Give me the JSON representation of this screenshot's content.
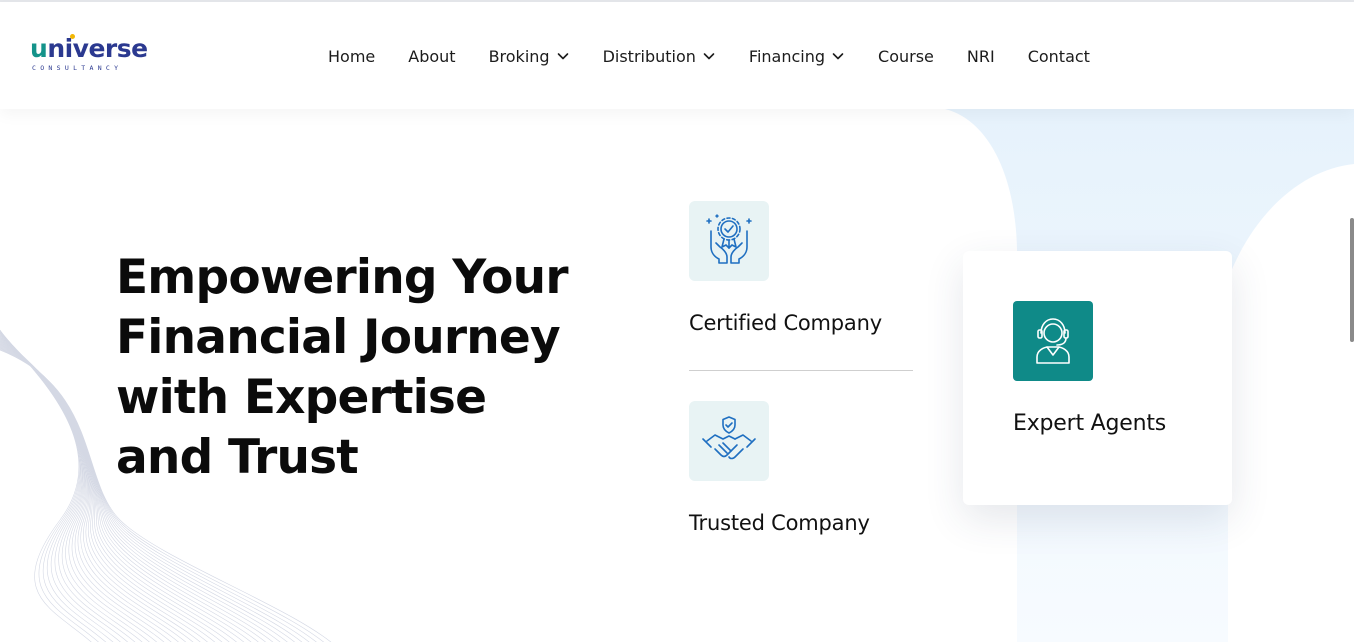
{
  "brand": {
    "name": "universe",
    "name_first_letter": "u",
    "name_rest": "niverse",
    "tagline": "CONSULTANCY",
    "colors": {
      "primary": "#2b3990",
      "accent": "#14938a",
      "dot": "#f2b705"
    }
  },
  "nav": {
    "items": [
      {
        "label": "Home",
        "dropdown": false
      },
      {
        "label": "About",
        "dropdown": false
      },
      {
        "label": "Broking",
        "dropdown": true
      },
      {
        "label": "Distribution",
        "dropdown": true
      },
      {
        "label": "Financing",
        "dropdown": true
      },
      {
        "label": "Course",
        "dropdown": false
      },
      {
        "label": "NRI",
        "dropdown": false
      },
      {
        "label": "Contact",
        "dropdown": false
      }
    ]
  },
  "hero": {
    "title_lines": [
      "Empowering Your",
      "Financial Journey",
      "with Expertise",
      "and Trust"
    ]
  },
  "features": [
    {
      "label": "Certified Company",
      "icon": "certificate-hands-icon"
    },
    {
      "label": "Trusted Company",
      "icon": "handshake-shield-icon"
    }
  ],
  "card": {
    "label": "Expert Agents",
    "icon": "support-agent-icon",
    "icon_bg": "#0f8a88"
  }
}
